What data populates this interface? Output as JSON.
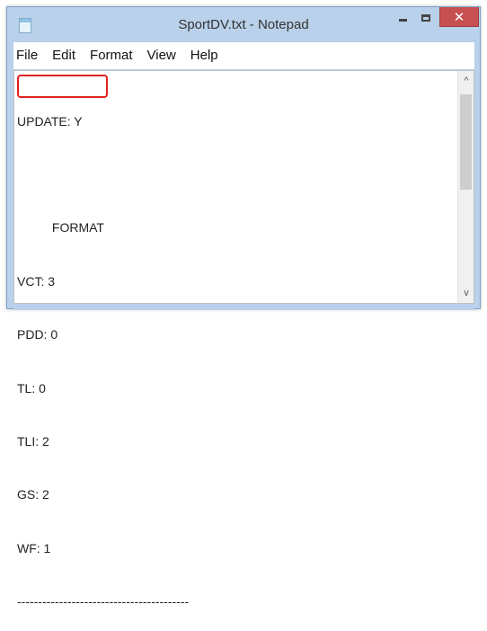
{
  "window": {
    "title": "SportDV.txt - Notepad",
    "accent_color": "#b9d1ea",
    "close_color": "#c75050"
  },
  "titlebar": {
    "icon": "notepad-icon",
    "minimize_icon": "minimize-icon",
    "maximize_icon": "maximize-icon",
    "close_glyph": "✕"
  },
  "menu": {
    "items": [
      "File",
      "Edit",
      "Format",
      "View",
      "Help"
    ]
  },
  "document": {
    "lines": [
      "UPDATE: Y",
      "",
      "          FORMAT",
      "VCT: 3",
      "PDD: 0",
      "TL: 0",
      "TLI: 2",
      "GS: 2",
      "WF: 1",
      "-----------------------------------------"
    ],
    "highlight_color": "#e02020"
  },
  "scrollbar": {
    "up_glyph": "^",
    "down_glyph": "v"
  }
}
